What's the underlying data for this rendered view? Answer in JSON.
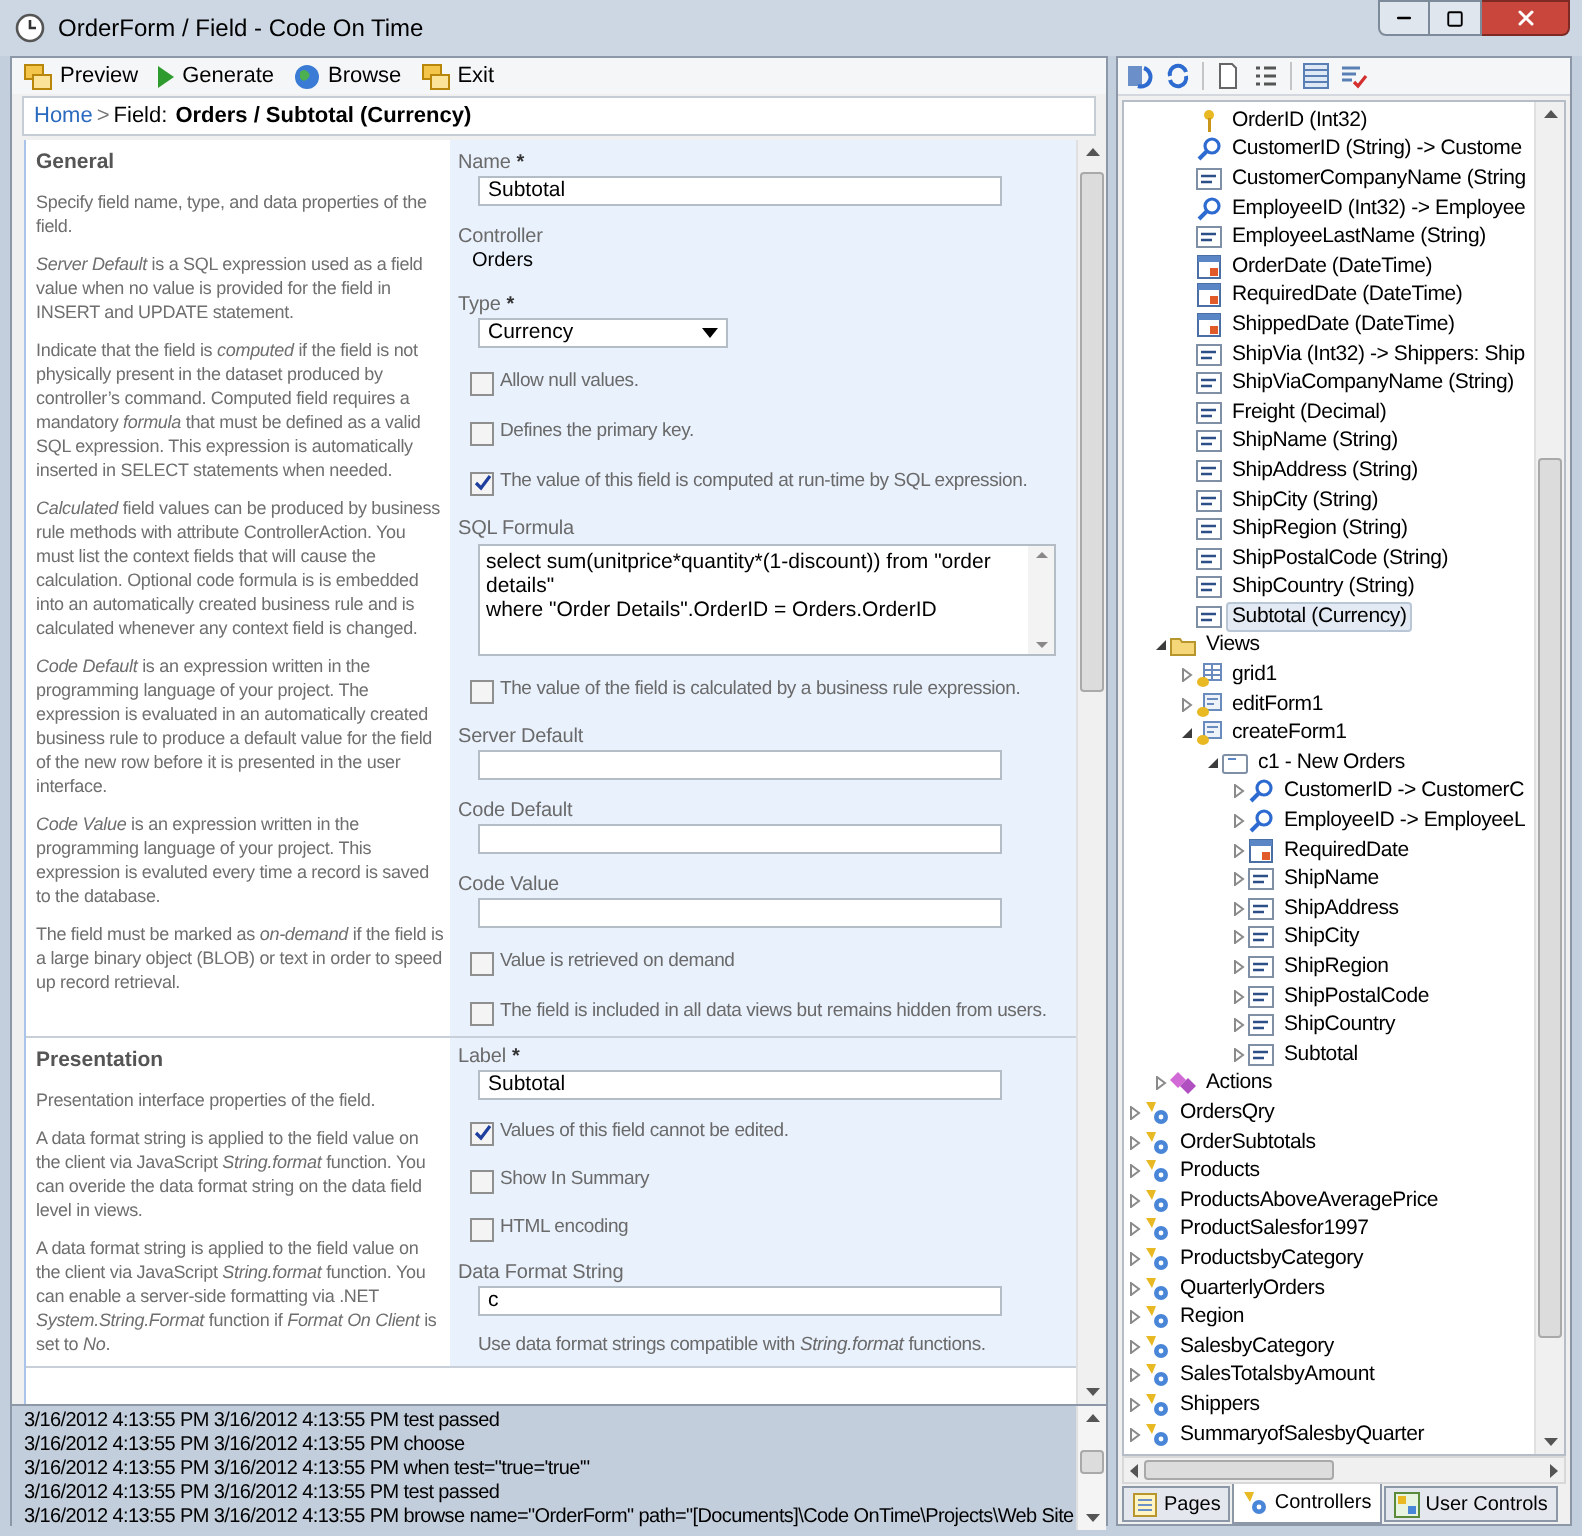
{
  "window": {
    "title": "OrderForm / Field - Code On Time"
  },
  "toolbar": [
    {
      "label": "Preview",
      "kind": "preview"
    },
    {
      "label": "Generate",
      "kind": "generate"
    },
    {
      "label": "Browse",
      "kind": "browse"
    },
    {
      "label": "Exit",
      "kind": "exit"
    }
  ],
  "breadcrumb": {
    "link": "Home",
    "separator": ">",
    "label": "Field:",
    "current": "Orders / Subtotal (Currency)"
  },
  "sections": [
    {
      "title": "General",
      "paragraphs": [
        "Specify field name, type, and data properties of the field.",
        "*Server Default* is a SQL expression used as a field value when no value is provided for the field in INSERT and UPDATE statement.",
        "Indicate that the field is *computed* if the field is not physically present in the dataset produced by controller’s command. Computed field requires a mandatory *formula* that must be defined as a valid SQL expression. This expression is automatically inserted in SELECT statements when needed.",
        "*Calculated* field values can be produced by business rule methods with attribute ControllerAction. You must list the context fields that will cause the calculation. Optional code formula is is embedded into an automatically created business rule and is calculated whenever any context field is changed.",
        "*Code Default* is an expression written in the programming language of your project. The expression is evaluated in an automatically created business rule to produce a default value for the field of the new row before it is presented in the user interface.",
        "*Code Value* is an expression written in the programming language of your project. This expression is evaluted every time a record is saved to the database.",
        "The field must be marked as *on-demand* if the field is a large binary object (BLOB) or text in order to speed up record retrieval."
      ],
      "fields": [
        {
          "kind": "text",
          "label": "Name",
          "marker": "*",
          "value": "Subtotal"
        },
        {
          "kind": "static",
          "label": "Controller",
          "value": "Orders"
        },
        {
          "kind": "select",
          "label": "Type",
          "marker": "*",
          "value": "Currency"
        },
        {
          "kind": "checkbox",
          "label": "Allow null values.",
          "checked": false
        },
        {
          "kind": "checkbox",
          "label": "Defines the primary key.",
          "checked": false
        },
        {
          "kind": "checkbox",
          "label": "The value of this field is computed at run-time by SQL expression.",
          "checked": true
        },
        {
          "kind": "textarea",
          "label": "SQL Formula",
          "value": "select sum(unitprice*quantity*(1-discount)) from \"order details\"\nwhere \"Order Details\".OrderID = Orders.OrderID"
        },
        {
          "kind": "checkbox",
          "label": "The value of the field is calculated by a business rule expression.",
          "checked": false
        },
        {
          "kind": "text",
          "label": "Server Default"
        },
        {
          "kind": "text",
          "label": "Code Default"
        },
        {
          "kind": "text",
          "label": "Code Value"
        },
        {
          "kind": "checkbox",
          "label": "Value is retrieved on demand",
          "checked": false
        },
        {
          "kind": "checkbox",
          "label": "The field is included in all data views but remains hidden from users.",
          "checked": false
        }
      ]
    },
    {
      "title": "Presentation",
      "paragraphs": [
        "Presentation interface properties of the field.",
        "A data format string is applied to the field value on the client via JavaScript *String.format* function. You can overide the data format string on the data field level in views.",
        "A data format string is applied to the field value on the client via JavaScript *String.format* function. You can enable a server-side formatting via .NET *System.String.Format* function if *Format On Client* is set to *No*."
      ],
      "fields": [
        {
          "kind": "text",
          "label": "Label",
          "marker": "*",
          "value": "Subtotal"
        },
        {
          "kind": "checkbox",
          "label": "Values of this field cannot be edited.",
          "checked": true
        },
        {
          "kind": "checkbox",
          "label": "Show In Summary",
          "checked": false
        },
        {
          "kind": "checkbox",
          "label": "HTML encoding",
          "checked": false
        },
        {
          "kind": "text",
          "label": "Data Format String",
          "value": "c"
        },
        {
          "kind": "hint",
          "label": "Use data format strings compatible with *String.format* functions."
        }
      ]
    }
  ],
  "log": [
    "3/16/2012 4:13:55 PM 3/16/2012 4:13:55 PM test passed",
    "3/16/2012 4:13:55 PM 3/16/2012 4:13:55 PM choose",
    "3/16/2012 4:13:55 PM 3/16/2012 4:13:55 PM when test=\"true='true'\"",
    "3/16/2012 4:13:55 PM 3/16/2012 4:13:55 PM test passed",
    "3/16/2012 4:13:55 PM 3/16/2012 4:13:55 PM browse name=\"OrderForm\" path=\"[Documents]\\Code OnTime\\Projects\\Web Site"
  ],
  "explorer": {
    "fields": [
      {
        "label": "OrderID (Int32)",
        "kind": "key",
        "selected": false
      },
      {
        "label": "CustomerID (String) -> Custome",
        "kind": "lookup",
        "selected": false
      },
      {
        "label": "CustomerCompanyName (String",
        "kind": "text",
        "selected": false
      },
      {
        "label": "EmployeeID (Int32) -> Employee",
        "kind": "lookup",
        "selected": false
      },
      {
        "label": "EmployeeLastName (String)",
        "kind": "text",
        "selected": false
      },
      {
        "label": "OrderDate (DateTime)",
        "kind": "date",
        "selected": false
      },
      {
        "label": "RequiredDate (DateTime)",
        "kind": "date",
        "selected": false
      },
      {
        "label": "ShippedDate (DateTime)",
        "kind": "date",
        "selected": false
      },
      {
        "label": "ShipVia (Int32) -> Shippers: Ship",
        "kind": "list",
        "selected": false
      },
      {
        "label": "ShipViaCompanyName (String)",
        "kind": "text",
        "selected": false
      },
      {
        "label": "Freight (Decimal)",
        "kind": "number",
        "selected": false
      },
      {
        "label": "ShipName (String)",
        "kind": "text",
        "selected": false
      },
      {
        "label": "ShipAddress (String)",
        "kind": "text",
        "selected": false
      },
      {
        "label": "ShipCity (String)",
        "kind": "text",
        "selected": false
      },
      {
        "label": "ShipRegion (String)",
        "kind": "text",
        "selected": false
      },
      {
        "label": "ShipPostalCode (String)",
        "kind": "text",
        "selected": false
      },
      {
        "label": "ShipCountry (String)",
        "kind": "text",
        "selected": false
      },
      {
        "label": "Subtotal (Currency)",
        "kind": "currency",
        "selected": true
      }
    ],
    "nodes": [
      {
        "label": "Views",
        "kind": "views",
        "expanded": true,
        "selected": false,
        "children": [
          {
            "label": "grid1",
            "kind": "grid",
            "expanded": false,
            "selected": false
          },
          {
            "label": "editForm1",
            "kind": "form",
            "expanded": false,
            "selected": false
          },
          {
            "label": "createForm1",
            "kind": "form",
            "expanded": true,
            "selected": false,
            "children": [
              {
                "label": "c1 - New Orders",
                "kind": "category",
                "expanded": true,
                "selected": false,
                "children": [
                  {
                    "label": "CustomerID -> CustomerC",
                    "kind": "lookup",
                    "expanded": false,
                    "selected": false
                  },
                  {
                    "label": "EmployeeID -> EmployeeL",
                    "kind": "lookup",
                    "expanded": false,
                    "selected": false
                  },
                  {
                    "label": "RequiredDate",
                    "kind": "date",
                    "expanded": false,
                    "selected": false
                  },
                  {
                    "label": "ShipName",
                    "kind": "text",
                    "expanded": false,
                    "selected": false
                  },
                  {
                    "label": "ShipAddress",
                    "kind": "text",
                    "expanded": false,
                    "selected": false
                  },
                  {
                    "label": "ShipCity",
                    "kind": "text",
                    "expanded": false,
                    "selected": false
                  },
                  {
                    "label": "ShipRegion",
                    "kind": "text",
                    "expanded": false,
                    "selected": false
                  },
                  {
                    "label": "ShipPostalCode",
                    "kind": "text",
                    "expanded": false,
                    "selected": false
                  },
                  {
                    "label": "ShipCountry",
                    "kind": "text",
                    "expanded": false,
                    "selected": false
                  },
                  {
                    "label": "Subtotal",
                    "kind": "currency",
                    "expanded": false,
                    "selected": false
                  }
                ]
              }
            ]
          }
        ]
      },
      {
        "label": "Actions",
        "kind": "actions",
        "expanded": false,
        "selected": false
      }
    ],
    "controllers": [
      {
        "label": "OrdersQry",
        "kind": "controller",
        "expanded": false,
        "selected": false
      },
      {
        "label": "OrderSubtotals",
        "kind": "controller",
        "expanded": false,
        "selected": false
      },
      {
        "label": "Products",
        "kind": "controller",
        "expanded": false,
        "selected": false
      },
      {
        "label": "ProductsAboveAveragePrice",
        "kind": "controller",
        "expanded": false,
        "selected": false
      },
      {
        "label": "ProductSalesfor1997",
        "kind": "controller",
        "expanded": false,
        "selected": false
      },
      {
        "label": "ProductsbyCategory",
        "kind": "controller",
        "expanded": false,
        "selected": false
      },
      {
        "label": "QuarterlyOrders",
        "kind": "controller",
        "expanded": false,
        "selected": false
      },
      {
        "label": "Region",
        "kind": "controller",
        "expanded": false,
        "selected": false
      },
      {
        "label": "SalesbyCategory",
        "kind": "controller",
        "expanded": false,
        "selected": false
      },
      {
        "label": "SalesTotalsbyAmount",
        "kind": "controller",
        "expanded": false,
        "selected": false
      },
      {
        "label": "Shippers",
        "kind": "controller",
        "expanded": false,
        "selected": false
      },
      {
        "label": "SummaryofSalesbyQuarter",
        "kind": "controller",
        "expanded": false,
        "selected": false
      }
    ],
    "tabs": [
      {
        "label": "Pages",
        "kind": "pages",
        "selected": false
      },
      {
        "label": "Controllers",
        "kind": "controllers",
        "selected": true
      },
      {
        "label": "User Controls",
        "kind": "user-controls",
        "selected": false
      }
    ]
  }
}
